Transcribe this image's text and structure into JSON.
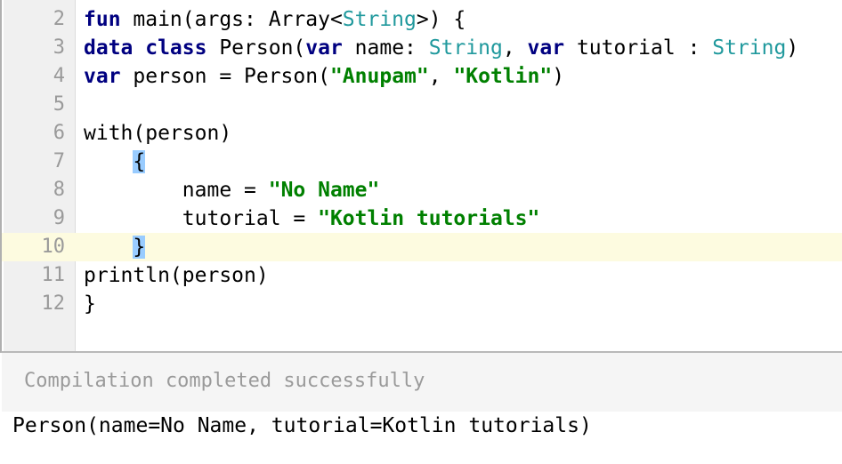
{
  "editor": {
    "lines": [
      {
        "number": "2",
        "tokens": [
          {
            "t": "fun",
            "c": "kw"
          },
          {
            "t": " main(args: Array<",
            "c": ""
          },
          {
            "t": "String",
            "c": "ty"
          },
          {
            "t": ">) {",
            "c": ""
          }
        ]
      },
      {
        "number": "3",
        "tokens": [
          {
            "t": "data class",
            "c": "kw"
          },
          {
            "t": " Person(",
            "c": ""
          },
          {
            "t": "var",
            "c": "kw"
          },
          {
            "t": " name: ",
            "c": ""
          },
          {
            "t": "String",
            "c": "ty"
          },
          {
            "t": ", ",
            "c": ""
          },
          {
            "t": "var",
            "c": "kw"
          },
          {
            "t": " tutorial : ",
            "c": ""
          },
          {
            "t": "String",
            "c": "ty"
          },
          {
            "t": ")",
            "c": ""
          }
        ]
      },
      {
        "number": "4",
        "tokens": [
          {
            "t": "var",
            "c": "kw"
          },
          {
            "t": " person = Person(",
            "c": ""
          },
          {
            "t": "\"Anupam\"",
            "c": "str"
          },
          {
            "t": ", ",
            "c": ""
          },
          {
            "t": "\"Kotlin\"",
            "c": "str"
          },
          {
            "t": ")",
            "c": ""
          }
        ]
      },
      {
        "number": "5",
        "tokens": []
      },
      {
        "number": "6",
        "tokens": [
          {
            "t": "with(person)",
            "c": ""
          }
        ]
      },
      {
        "number": "7",
        "tokens": [
          {
            "t": "    ",
            "c": ""
          },
          {
            "t": "{",
            "c": "brace"
          }
        ]
      },
      {
        "number": "8",
        "tokens": [
          {
            "t": "        name = ",
            "c": ""
          },
          {
            "t": "\"No Name\"",
            "c": "str"
          }
        ]
      },
      {
        "number": "9",
        "tokens": [
          {
            "t": "        tutorial = ",
            "c": ""
          },
          {
            "t": "\"Kotlin tutorials\"",
            "c": "str"
          }
        ]
      },
      {
        "number": "10",
        "tokens": [
          {
            "t": "    ",
            "c": ""
          },
          {
            "t": "}",
            "c": "brace"
          }
        ],
        "current": true
      },
      {
        "number": "11",
        "tokens": [
          {
            "t": "println(person)",
            "c": ""
          }
        ]
      },
      {
        "number": "12",
        "tokens": [
          {
            "t": "}",
            "c": ""
          }
        ]
      }
    ]
  },
  "console": {
    "status": "Compilation completed successfully",
    "output": "Person(name=No Name, tutorial=Kotlin tutorials)"
  },
  "colors": {
    "keyword": "#000080",
    "type": "#20999d",
    "string": "#008000",
    "brace_match": "#99ccff",
    "current_line": "#fdfbe0"
  }
}
